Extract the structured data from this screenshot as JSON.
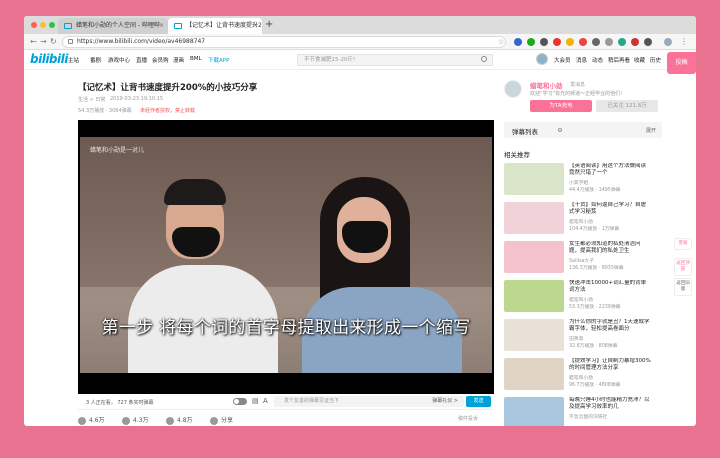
{
  "browser": {
    "tabs": [
      {
        "label": "蜡笔和小勋的个人空间 - 哔哩哔",
        "active": false
      },
      {
        "label": "【记忆术】让背书速度提升2",
        "active": true
      }
    ],
    "new_tab": "+",
    "url": "https://www.bilibili.com/video/av46988747"
  },
  "site": {
    "logo": "bilibili",
    "nav": [
      "主站",
      "番剧",
      "游戏中心",
      "直播",
      "会员购",
      "漫画",
      "BML",
      "下载APP"
    ],
    "search_placeholder": "不节食减肥15-20斤!",
    "header_right": [
      "大会员",
      "消息",
      "动态",
      "稍后再看",
      "收藏",
      "历史"
    ],
    "upload_label": "投稿"
  },
  "video": {
    "title": "【记忆术】让背书速度提升200%的小技巧分享",
    "category": "生活 > 日常",
    "date": "2019-03-23 19:10:15",
    "views": "54.3万播放 · 3064弹幕",
    "notice": "未经作者授权，禁止转载",
    "uploader_mark": "蜡笔和小勋是一对儿",
    "subtitle": "第一步 将每个词的首字母提取出来形成一个缩写",
    "watching": "3 人正在看，  727 条实时弹幕",
    "danmaku_placeholder": "发个友善的弹幕见证当下",
    "danmaku_etiquette": "弹幕礼仪 >",
    "send_label": "发送",
    "actions": [
      {
        "name": "like",
        "label": "4.6万"
      },
      {
        "name": "coin",
        "label": "4.3万"
      },
      {
        "name": "favorite",
        "label": "4.8万"
      },
      {
        "name": "share",
        "label": "分享"
      }
    ],
    "report": "稿件投诉"
  },
  "uploader": {
    "name": "蜡笔和小勋",
    "message": "发消息",
    "desc": "欢迎“学习”有光的频道～正经毕业的他们！",
    "charge": "为TA充电",
    "follow": "已关注 121.8万"
  },
  "danmaku_list": {
    "title": "弹幕列表",
    "expand": "展开"
  },
  "related": {
    "title": "相关推荐",
    "items": [
      {
        "title": "【英语阅读】用这个方法做阅读 竟然只错了一个",
        "author": "小高学姐",
        "stats": "44.4万播放 · 1495弹幕",
        "color": "#d9e4c8"
      },
      {
        "title": "【干货】如何逼自己学习？自虐式学习秘笈",
        "author": "蜡笔和小勋",
        "stats": "104.4万播放 · 1万弹幕",
        "color": "#f1d2d9"
      },
      {
        "title": "女生都必须知道的私处清洁问题，提高我们的私处卫生",
        "author": "Sailisa大子",
        "stats": "136.3万播放 · 8935弹幕",
        "color": "#f3c2cc"
      },
      {
        "title": "快速冲击10000+词汇量的背单词方法",
        "author": "蜡笔和小勋",
        "stats": "53.3万播放 · 2239弹幕",
        "color": "#bcd88e"
      },
      {
        "title": "为什么你的字就是丑？1天速成学霸字体，轻松提高卷面分",
        "author": "田英章",
        "stats": "32.8万播放 · 808弹幕",
        "color": "#e8e1d8"
      },
      {
        "title": "【提效学习】让自制力暴增300%的时间管理方法分享",
        "author": "蜡笔和小勋",
        "stats": "96.7万播放 · 4808弹幕",
        "color": "#e0d5c4"
      },
      {
        "title": "每晚只睡4小时也能精力充沛？以及提高学习效率的几",
        "author": "不急云盘的深研社",
        "stats": "",
        "color": "#a9c7df"
      }
    ]
  },
  "side_buttons": [
    "返回顶部",
    "客服",
    "返回旧版"
  ]
}
